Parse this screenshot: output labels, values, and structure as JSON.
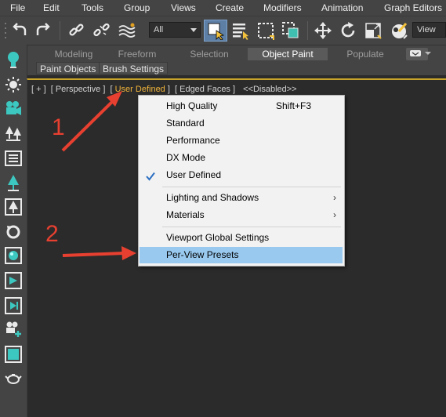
{
  "menubar": {
    "items": [
      "File",
      "Edit",
      "Tools",
      "Group",
      "Views",
      "Create",
      "Modifiers",
      "Animation",
      "Graph Editors"
    ]
  },
  "toolbar": {
    "selection_filter": "All",
    "reference_coord": "View"
  },
  "ribbon": {
    "tabs": [
      "Modeling",
      "Freeform",
      "Selection",
      "Object Paint",
      "Populate"
    ],
    "active_tab": "Object Paint",
    "subtabs": [
      "Paint Objects",
      "Brush Settings"
    ]
  },
  "viewport": {
    "labels": [
      "[ + ]",
      "[ Perspective ]",
      "[",
      "User Defined",
      "]",
      "[ Edged Faces ]",
      "<<Disabled>>"
    ]
  },
  "context_menu": {
    "items": [
      {
        "label": "High Quality",
        "shortcut": "Shift+F3"
      },
      {
        "label": "Standard"
      },
      {
        "label": "Performance"
      },
      {
        "label": "DX Mode"
      },
      {
        "label": "User Defined",
        "checked": true
      },
      {
        "label": "Lighting and Shadows",
        "submenu": true
      },
      {
        "label": "Materials",
        "submenu": true
      },
      {
        "label": "Viewport Global Settings"
      },
      {
        "label": "Per-View Presets",
        "highlighted": true
      }
    ],
    "submenu_arrow": "›",
    "checkmark": "✔"
  },
  "annotations": {
    "step1": "1",
    "step2": "2",
    "arrow_color": "#e84030"
  },
  "colors": {
    "ui_bg": "#444444",
    "viewport_bg": "#2b2b2b",
    "active_border": "#c8a52a",
    "highlight_text": "#f0b33a",
    "menu_selected": "#99c9ef"
  }
}
